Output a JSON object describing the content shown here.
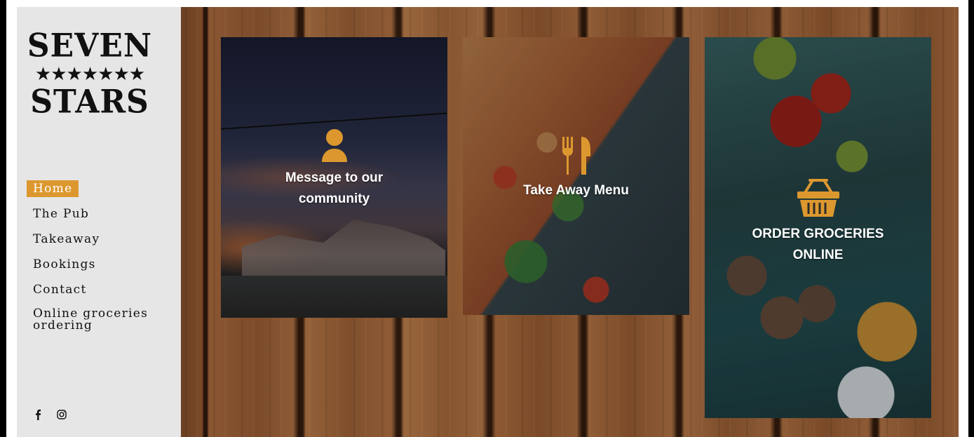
{
  "brand": {
    "line1": "SEVEN",
    "stars": "★★★★★★★",
    "line2": "STARS"
  },
  "nav": {
    "items": [
      {
        "label": "Home",
        "active": true
      },
      {
        "label": "The Pub"
      },
      {
        "label": "Takeaway"
      },
      {
        "label": "Bookings"
      },
      {
        "label": "Contact"
      },
      {
        "label": "Online groceries ordering"
      }
    ]
  },
  "social": {
    "icons": [
      "facebook-icon",
      "instagram-icon"
    ]
  },
  "cards": [
    {
      "label": "Message to our community",
      "icon": "user-icon"
    },
    {
      "label": "Take Away Menu",
      "icon": "cutlery-icon"
    },
    {
      "label": "ORDER GROCERIES ONLINE",
      "icon": "basket-icon"
    }
  ],
  "colors": {
    "accent": "#dc982f",
    "sidebar": "#e6e6e6"
  }
}
